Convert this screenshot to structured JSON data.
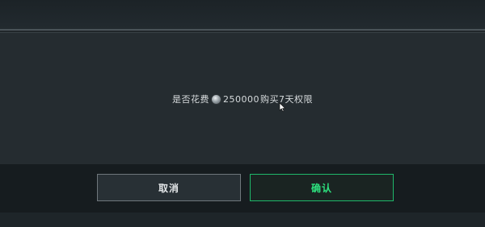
{
  "dialog": {
    "message_prefix": "是否花费",
    "currency_icon": "silver-coin-icon",
    "amount": "250000",
    "message_suffix": "购买7天权限"
  },
  "buttons": {
    "cancel_label": "取消",
    "confirm_label": "确认"
  },
  "colors": {
    "confirm_accent": "#2ee27f",
    "confirm_border": "#1fb86a",
    "cancel_border": "#6f777c"
  }
}
